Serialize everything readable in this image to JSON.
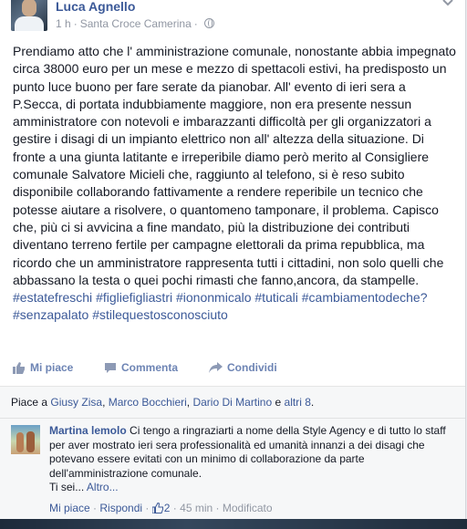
{
  "post": {
    "author": "Luca Agnello",
    "time": "1 h",
    "separator": "·",
    "location": "Santa Croce Camerina",
    "separator2": "·",
    "body": "Prendiamo atto che l' amministrazione comunale, nonostante abbia impegnato circa 38000 euro per un mese e mezzo di spettacoli estivi, ha predisposto un punto luce buono per fare serate da pianobar. All' evento di ieri sera a P.Secca, di portata indubbiamente maggiore, non era presente nessun amministratore con notevoli e imbarazzanti difficoltà per gli organizzatori a gestire i disagi di un impianto elettrico non all' altezza della situazione. Di fronte a una giunta latitante e irreperibile diamo però merito al Consigliere comunale Salvatore Micieli che, raggiunto al telefono, si è reso subito disponibile collaborando fattivamente a rendere reperibile un tecnico che potesse aiutare a risolvere, o quantomeno tamponare, il problema. Capisco che, più ci si avvicina a fine mandato, più la distribuzione dei contributi diventano terreno fertile per campagne elettorali da prima repubblica, ma ricordo che un amministratore rappresenta tutti i cittadini, non solo quelli che abbassano la testa o quei pochi rimasti che fanno,ancora, da stampelle.",
    "hashtags": [
      "#estatefreschi",
      "#figliefigliastri",
      "#iononmicalo",
      "#tuticali",
      "#cambiamentodeche?",
      "#senzapalato",
      "#stilequestosconosciuto"
    ]
  },
  "actions": {
    "like": "Mi piace",
    "comment": "Commenta",
    "share": "Condividi"
  },
  "likes": {
    "prefix": "Piace a",
    "names": [
      "Giusy Zisa",
      "Marco Bocchieri",
      "Dario Di Martino"
    ],
    "sep": ",",
    "conjunction": "e",
    "others": "altri 8",
    "period": "."
  },
  "comment": {
    "author": "Martina lemolo",
    "text": "Ci tengo a ringraziarti a nome della Style Agency e di tutto lo staff per aver mostrato ieri sera professionalità ed umanità innanzi a dei disagi che potevano essere evitati con un minimo di collaborazione da parte dell'amministrazione comunale.",
    "text2": "Ti sei...",
    "more": "Altro...",
    "like": "Mi piace",
    "dot": "·",
    "reply": "Rispondi",
    "like_count": "2",
    "time": "45 min",
    "edited": "Modificato"
  },
  "colors": {
    "link": "#3b5998",
    "meta": "#9197a3",
    "action": "#6d84b4"
  },
  "icons": [
    "globe-icon",
    "chevron-down-icon",
    "like-thumb-icon",
    "comment-bubble-icon",
    "share-arrow-icon"
  ]
}
